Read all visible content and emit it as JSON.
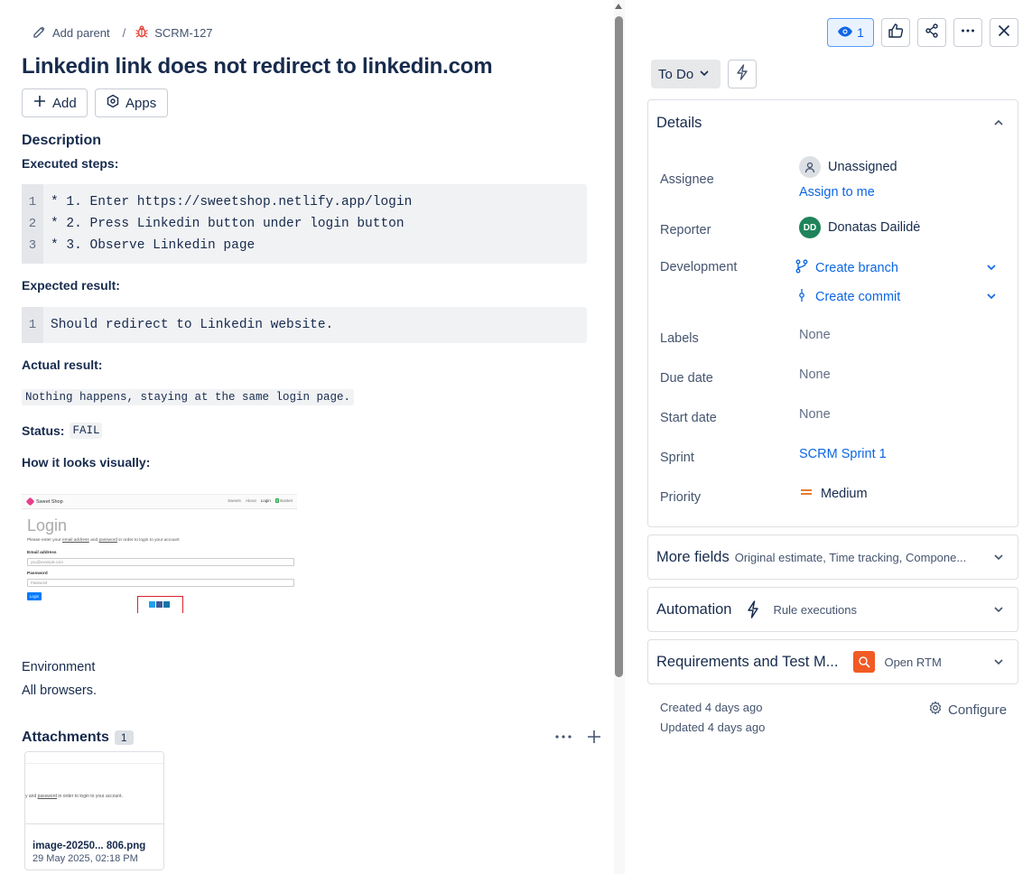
{
  "breadcrumb": {
    "add_parent": "Add parent",
    "separator": "/",
    "issue_key": "SCRM-127"
  },
  "issue": {
    "title": "Linkedin link does not redirect to linkedin.com"
  },
  "toolbar": {
    "add_label": "Add",
    "apps_label": "Apps"
  },
  "description": {
    "heading": "Description",
    "executed_steps_heading": "Executed steps:",
    "executed_steps": [
      {
        "num": "1",
        "text": "* 1. Enter https://sweetshop.netlify.app/login"
      },
      {
        "num": "2",
        "text": "* 2. Press Linkedin button under login button"
      },
      {
        "num": "3",
        "text": "* 3. Observe Linkedin page"
      }
    ],
    "expected_heading": "Expected result:",
    "expected_lines": [
      {
        "num": "1",
        "text": "Should redirect to Linkedin website."
      }
    ],
    "actual_heading": "Actual result:",
    "actual_text": "Nothing happens, staying at the same login page.",
    "status_label": "Status:",
    "status_value": "FAIL",
    "visual_heading": "How it looks visually:"
  },
  "embedded_screenshot": {
    "brand": "Sweet Shop",
    "nav": [
      "Sweets",
      "About",
      "Login"
    ],
    "basket_count": "0",
    "basket_label": "Basket",
    "heading": "Login",
    "instructions_pre": "Please enter your ",
    "instructions_link1": "email address",
    "instructions_mid": " and ",
    "instructions_link2": "password",
    "instructions_post": " in order to login to your account",
    "email_label": "Email address",
    "email_placeholder": "you@example.com",
    "password_label": "Password",
    "password_placeholder": "Password",
    "login_button": "Login"
  },
  "environment": {
    "label": "Environment",
    "value": "All browsers."
  },
  "attachments": {
    "heading": "Attachments",
    "count": "1",
    "preview_text_pre": "y and ",
    "preview_text_link": "password",
    "preview_text_post": " in order to login to your account.",
    "file_name": "image-20250... 806.png",
    "file_date": "29 May 2025, 02:18 PM"
  },
  "header_actions": {
    "watch_count": "1"
  },
  "status": {
    "label": "To Do"
  },
  "details": {
    "title": "Details",
    "assignee_label": "Assignee",
    "assignee_value": "Unassigned",
    "assign_to_me": "Assign to me",
    "reporter_label": "Reporter",
    "reporter_initials": "DD",
    "reporter_name": "Donatas Dailidė",
    "development_label": "Development",
    "create_branch": "Create branch",
    "create_commit": "Create commit",
    "labels_label": "Labels",
    "labels_value": "None",
    "due_date_label": "Due date",
    "due_date_value": "None",
    "start_date_label": "Start date",
    "start_date_value": "None",
    "sprint_label": "Sprint",
    "sprint_value": "SCRM Sprint 1",
    "priority_label": "Priority",
    "priority_value": "Medium"
  },
  "more_fields": {
    "title": "More fields",
    "subtitle": "Original estimate, Time tracking, Compone..."
  },
  "automation": {
    "title": "Automation",
    "subtitle": "Rule executions"
  },
  "requirements": {
    "title": "Requirements and Test M...",
    "subtitle": "Open RTM"
  },
  "meta": {
    "created": "Created 4 days ago",
    "updated": "Updated 4 days ago",
    "configure": "Configure"
  },
  "colors": {
    "link": "#0c66e4",
    "watch_bg": "#e9f2ff",
    "reporter_avatar": "#1f845a",
    "priority_medium": "#e56910",
    "rtm_brand": "#f15a24",
    "bug_icon": "#e2483d"
  }
}
